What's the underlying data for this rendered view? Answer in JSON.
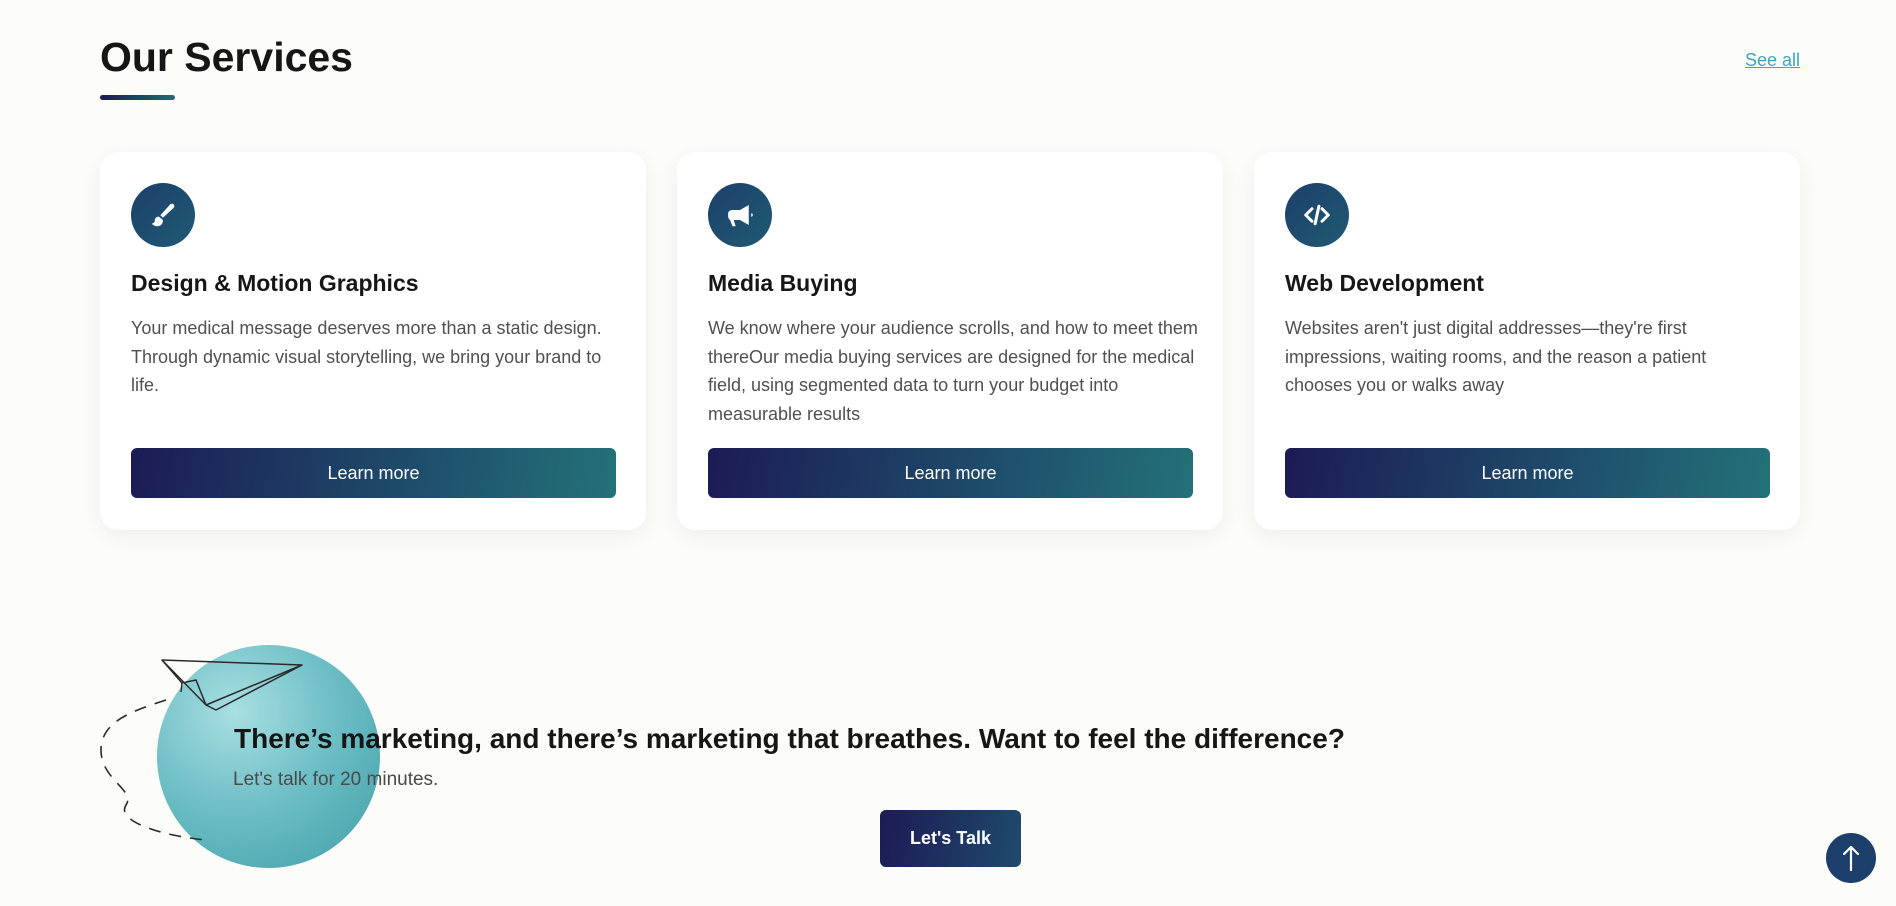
{
  "header": {
    "title": "Our Services",
    "see_all": "See all"
  },
  "services": [
    {
      "icon": "paintbrush-icon",
      "title": "Design & Motion Graphics",
      "description": "Your medical message deserves more than a static design. Through dynamic visual storytelling, we bring your brand to life.",
      "button": "Learn more"
    },
    {
      "icon": "megaphone-icon",
      "title": "Media Buying",
      "description": "We know where your audience scrolls, and how to meet them thereOur media buying services are designed for the medical field, using segmented data to turn your budget into measurable results",
      "button": "Learn more"
    },
    {
      "icon": "code-icon",
      "title": "Web Development",
      "description": "Websites aren't just digital addresses—they're first impressions, waiting rooms, and the reason a patient chooses you or walks away",
      "button": "Learn more"
    }
  ],
  "cta": {
    "heading": "There’s marketing, and there’s marketing that breathes. Want to feel the difference?",
    "subheading": "Let's talk for 20 minutes.",
    "button": "Let's Talk"
  },
  "colors": {
    "accent_dark": "#1c1b54",
    "accent_teal": "#237278",
    "link": "#3aa7c0",
    "background": "#fcfcf8"
  }
}
